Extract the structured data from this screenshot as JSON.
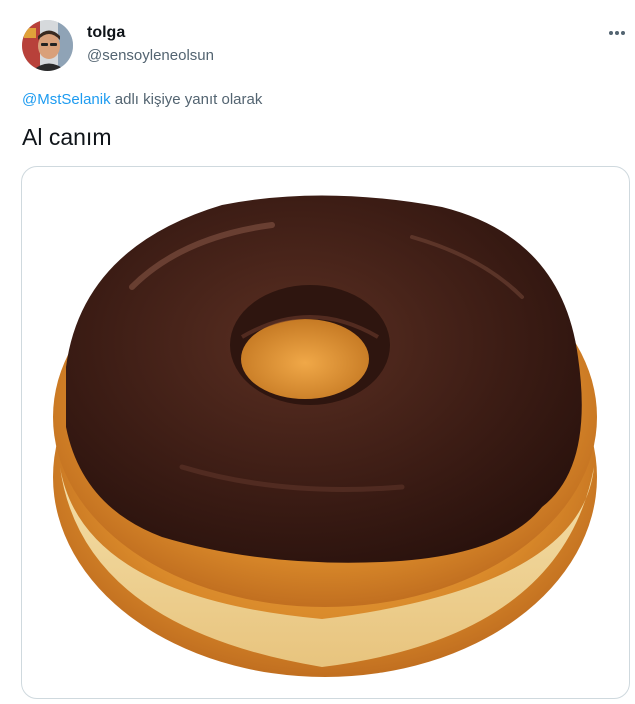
{
  "user": {
    "display_name": "tolga",
    "handle": "@sensoyleneolsun"
  },
  "reply": {
    "mention": "@MstSelanik",
    "text": "adlı kişiye yanıt olarak"
  },
  "tweet": {
    "text": "Al canım"
  },
  "media": {
    "subject": "chocolate-glazed-donut"
  },
  "colors": {
    "accent": "#1d9bf0",
    "text_primary": "#0f1419",
    "text_secondary": "#536471",
    "border": "#cfd9de"
  },
  "icons": {
    "more": "more-horizontal-icon"
  }
}
